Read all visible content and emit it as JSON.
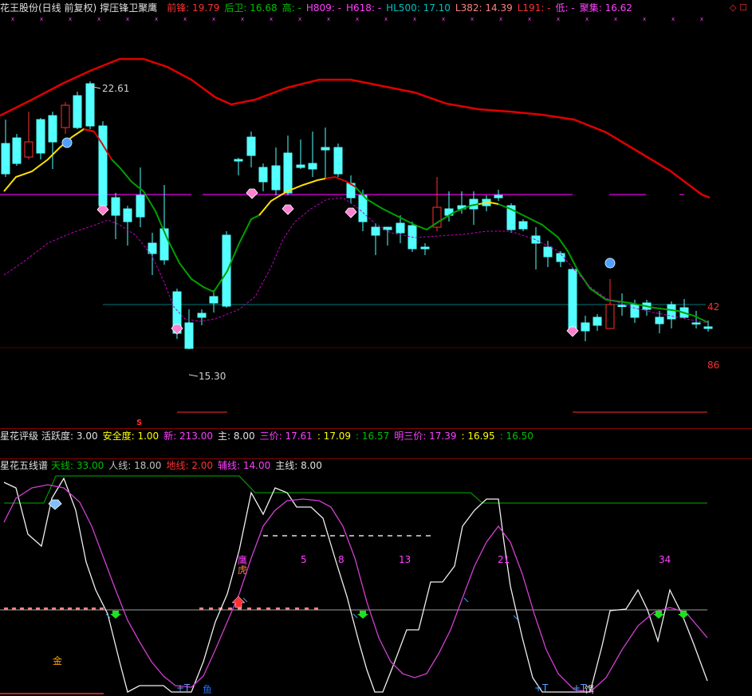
{
  "header": {
    "stock_title": "花王股份(日线 前复权)",
    "indicator_title": "撑压锋卫聚鹰",
    "items": [
      {
        "label": "前锋:",
        "value": "19.79",
        "color": "#ff3030"
      },
      {
        "label": "后卫:",
        "value": "16.68",
        "color": "#00c000"
      },
      {
        "label": "高:",
        "value": "-",
        "color": "#00c000"
      },
      {
        "label": "H809:",
        "value": "-",
        "color": "#ff40ff"
      },
      {
        "label": "H618:",
        "value": "-",
        "color": "#ff40ff"
      },
      {
        "label": "HL500:",
        "value": "17.10",
        "color": "#00c0c0"
      },
      {
        "label": "L382:",
        "value": "14.39",
        "color": "#ff8080"
      },
      {
        "label": "L191:",
        "value": "-",
        "color": "#ff3030"
      },
      {
        "label": "低:",
        "value": "-",
        "color": "#ff40ff"
      },
      {
        "label": "聚集:",
        "value": "16.62",
        "color": "#ff40ff"
      }
    ],
    "corner_glyph": "◇ ☐"
  },
  "price_chart": {
    "high_label": "22.61",
    "low_label": "15.30",
    "right_label_1": "42",
    "right_label_2": "86",
    "marker": "S"
  },
  "rating_bar": {
    "title": "星花评级",
    "items": [
      {
        "label": "活跃度:",
        "value": "3.00",
        "color": "#e0e0e0"
      },
      {
        "label": "安全度:",
        "value": "1.00",
        "color": "#ffff00"
      },
      {
        "label": "新:",
        "value": "213.00",
        "color": "#ff40ff"
      },
      {
        "label": "主:",
        "value": "8.00",
        "color": "#e0e0e0"
      },
      {
        "label": "三价:",
        "value": "17.61",
        "color": "#ff40ff"
      },
      {
        "label": ":",
        "value": "17.09",
        "color": "#ffff00"
      },
      {
        "label": ":",
        "value": "16.57",
        "color": "#00c000"
      },
      {
        "label": "明三价:",
        "value": "17.39",
        "color": "#ff40ff"
      },
      {
        "label": ":",
        "value": "16.95",
        "color": "#ffff00"
      },
      {
        "label": ":",
        "value": "16.50",
        "color": "#00c000"
      }
    ]
  },
  "five_line_bar": {
    "title": "星花五线谱",
    "items": [
      {
        "label": "天线:",
        "value": "33.00",
        "color": "#00c000"
      },
      {
        "label": "人线:",
        "value": "18.00",
        "color": "#c0c0c0"
      },
      {
        "label": "地线:",
        "value": "2.00",
        "color": "#ff3030"
      },
      {
        "label": "辅线:",
        "value": "14.00",
        "color": "#ff40ff"
      },
      {
        "label": "主线:",
        "value": "8.00",
        "color": "#e0e0e0"
      }
    ]
  },
  "oscillator": {
    "counts": [
      "5",
      "8",
      "13",
      "21",
      "34"
    ],
    "glyph_eagle": "鹰",
    "glyph_tiger": "虎",
    "glyph_gold": "金",
    "glyph_fish": "鱼",
    "glyph_bait": "饵",
    "plus_t": "+T"
  },
  "colors": {
    "bull": "#ff3030",
    "bear": "#54ffff",
    "ma_red": "#e00000",
    "ma_green": "#00a000",
    "support": "#c000c0",
    "teal": "#008080"
  }
}
